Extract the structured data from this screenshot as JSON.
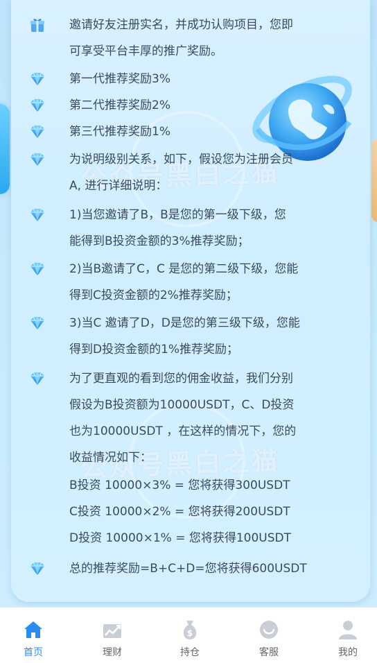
{
  "intro": {
    "line1": "邀请好友注册实名，并成功认购项目，您即",
    "line2": "可享受平台丰厚的推广奖励。"
  },
  "rewards": [
    "第一代推荐奖励3%",
    "第二代推荐奖励2%",
    "第三代推荐奖励1%"
  ],
  "explain": {
    "line1": "为说明级别关系，如下，假设您为注册会员",
    "line2": "A, 进行详细说明："
  },
  "levels": [
    {
      "line1": "1)当您邀请了B，B是您的第一级下级，您",
      "line2": "能得到B投资金额的3%推荐奖励；"
    },
    {
      "line1": "2)当B邀请了C，C 是您的第二级下级，您能",
      "line2": "得到C投资金额的2%推荐奖励；"
    },
    {
      "line1": "3)当C 邀请了D，D是您的第三级下级，您能",
      "line2": "得到D投资金额的1%推荐奖励；"
    }
  ],
  "example": {
    "line1": "为了更直观的看到您的佣金收益，我们分别",
    "line2": "假设为B投资额为10000USDT，C、D投资",
    "line3": "也为10000USDT ，在这样的情况下，您的",
    "line4": "收益情况如下：",
    "calc": [
      "B投资 10000×3% = 您将获得300USDT",
      "C投资 10000×2% = 您将获得200USDT",
      "D投资 10000×1% = 您将获得100USDT"
    ]
  },
  "total": "总的推荐奖励=B+C+D=您将获得600USDT",
  "watermark": "公众号黑白之猫",
  "tabs": [
    {
      "label": "首页",
      "icon": "home-icon",
      "active": true
    },
    {
      "label": "理财",
      "icon": "chart-icon",
      "active": false
    },
    {
      "label": "持仓",
      "icon": "money-bag-icon",
      "active": false
    },
    {
      "label": "客服",
      "icon": "service-icon",
      "active": false
    },
    {
      "label": "我的",
      "icon": "user-icon",
      "active": false
    }
  ],
  "colors": {
    "accent": "#2a8cf0",
    "text": "#3b4a5c",
    "background": "#cfeefe"
  }
}
